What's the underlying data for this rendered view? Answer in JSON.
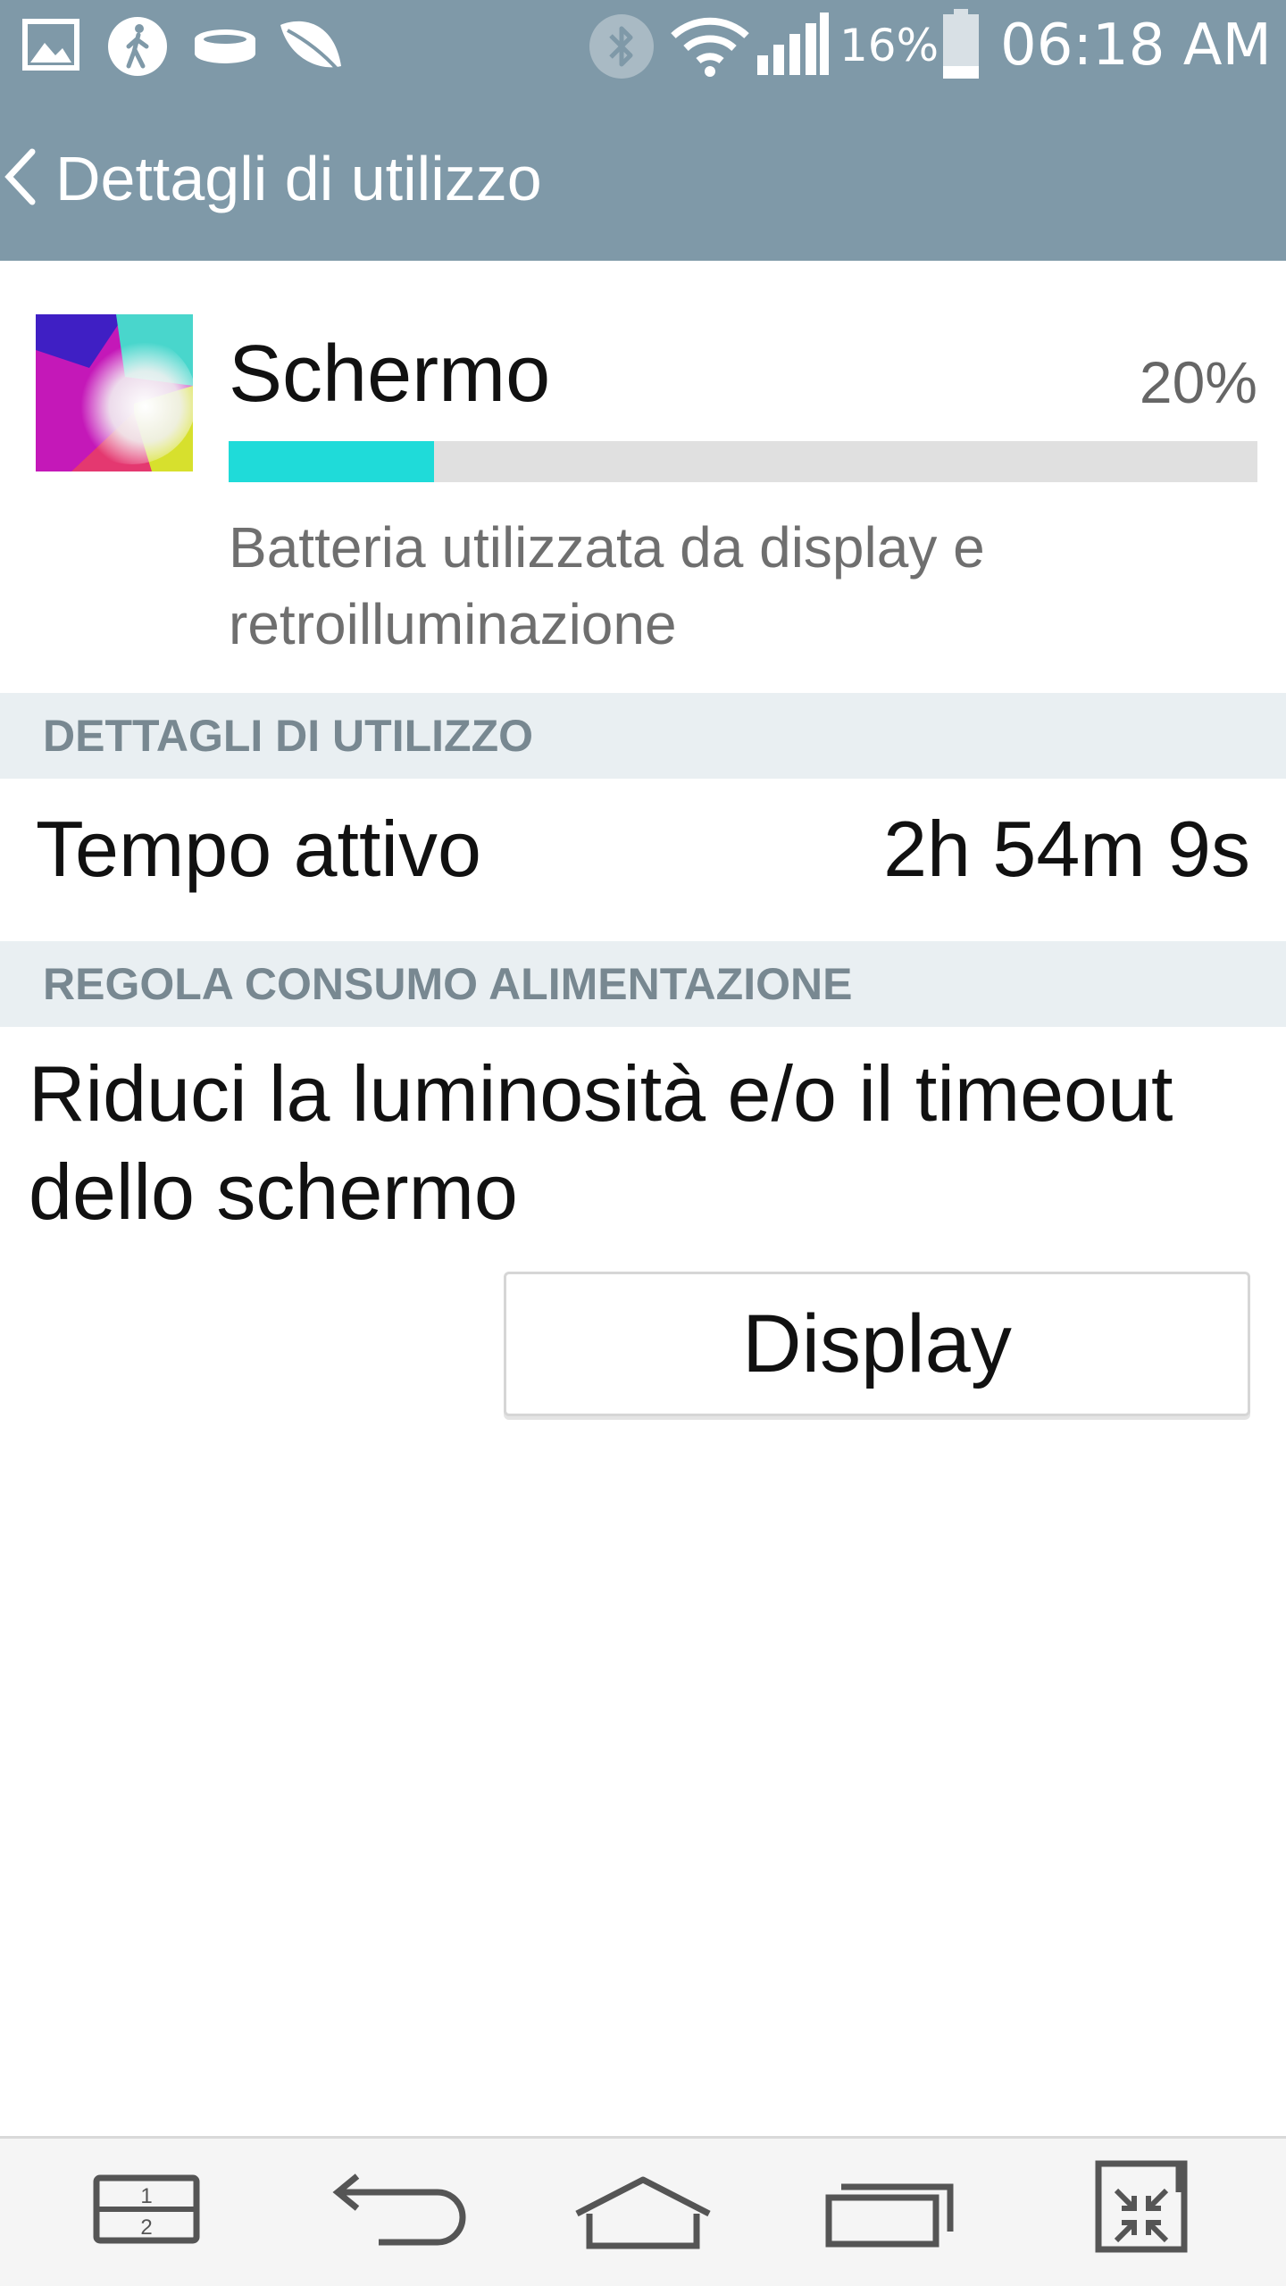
{
  "status_bar": {
    "battery_percent": "16%",
    "time": "06:18 AM"
  },
  "app_bar": {
    "title": "Dettagli di utilizzo"
  },
  "app_summary": {
    "name": "Schermo",
    "percent_label": "20%",
    "usage_fraction": 0.2,
    "description": "Batteria utilizzata da display e retroilluminazione",
    "bar_color": "#1fdbd9"
  },
  "usage_section": {
    "header": "DETTAGLI DI UTILIZZO",
    "row_label": "Tempo attivo",
    "row_value": "2h 54m 9s"
  },
  "power_section": {
    "header": "REGOLA CONSUMO ALIMENTAZIONE",
    "tip": "Riduci la luminosità e/o il timeout dello schermo",
    "button_label": "Display"
  },
  "nav": {
    "dual_window_digits": [
      "1",
      "2"
    ],
    "icons": [
      "dual-window-icon",
      "back-icon",
      "home-icon",
      "recent-apps-icon",
      "mini-view-icon"
    ]
  },
  "colors": {
    "header_bg": "#7f99a8",
    "section_bg": "#e9eff2",
    "accent": "#1fdbd9"
  }
}
